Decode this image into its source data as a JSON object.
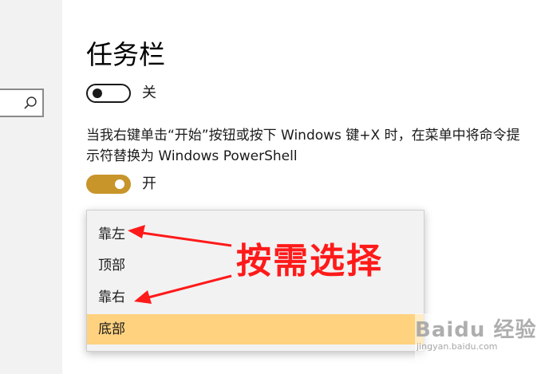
{
  "section": {
    "title": "任务栏",
    "lock_toggle": {
      "state_label": "关"
    },
    "powershell_description": "当我右键单击“开始”按钮或按下 Windows 键+X 时，在菜单中将命令提示符替换为 Windows PowerShell",
    "powershell_toggle": {
      "state_label": "开"
    }
  },
  "position_dropdown": {
    "options": [
      "靠左",
      "顶部",
      "靠右",
      "底部"
    ],
    "selected": "底部"
  },
  "annotation": {
    "text": "按需选择",
    "color": "#ff1a1a"
  },
  "watermark": {
    "logo": "Baidu 经验",
    "url": "jingyan.baidu.com"
  },
  "colors": {
    "accent": "#c8952b",
    "selected_option": "#ffd27f",
    "sidebar": "#f2f2f2"
  },
  "icons": {
    "search": "search-icon"
  }
}
